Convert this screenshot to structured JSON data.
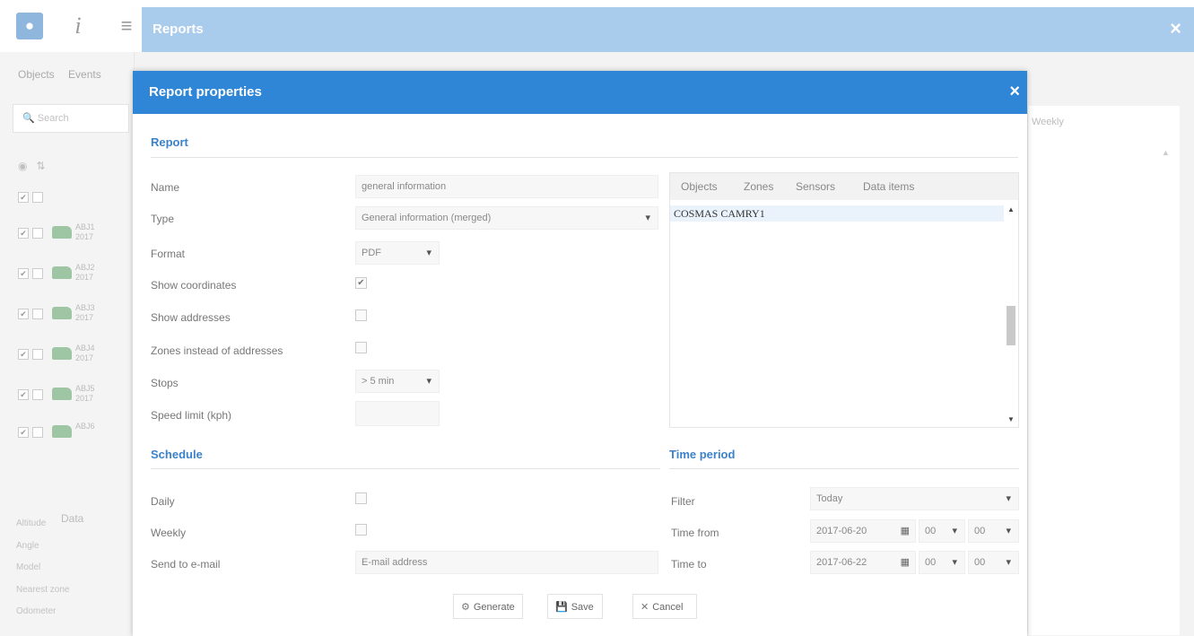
{
  "app": {
    "reports_title": "Reports",
    "close_glyph": "×"
  },
  "left_panel": {
    "tabs": [
      "Objects",
      "Events"
    ],
    "search_placeholder": "Search",
    "objects": [
      {
        "name": "ABJ1",
        "sub": "2017"
      },
      {
        "name": "ABJ2",
        "sub": "2017"
      },
      {
        "name": "ABJ3",
        "sub": "2017"
      },
      {
        "name": "ABJ4",
        "sub": "2017"
      },
      {
        "name": "ABJ5",
        "sub": "2017"
      },
      {
        "name": "ABJ6",
        "sub": ""
      }
    ],
    "data_tab": "Data",
    "properties": [
      "Altitude",
      "Angle",
      "Model",
      "Nearest zone",
      "Odometer"
    ]
  },
  "background": {
    "weekly_label": "Weekly"
  },
  "dialog": {
    "title": "Report properties",
    "close_glyph": "×",
    "report_section": "Report",
    "labels": {
      "name": "Name",
      "type": "Type",
      "format": "Format",
      "show_coordinates": "Show coordinates",
      "show_addresses": "Show addresses",
      "zones_instead": "Zones instead of addresses",
      "stops": "Stops",
      "speed_limit": "Speed limit (kph)"
    },
    "values": {
      "name": "general information",
      "type": "General information (merged)",
      "format": "PDF",
      "stops": "> 5 min",
      "speed_limit": ""
    },
    "checks": {
      "show_coordinates": "✔",
      "show_addresses": "",
      "zones_instead": ""
    },
    "object_tabs": [
      "Objects",
      "Zones",
      "Sensors",
      "Data items"
    ],
    "objects": [
      "COSMAS CAMRY1"
    ],
    "schedule_section": "Schedule",
    "schedule": {
      "daily": "Daily",
      "weekly": "Weekly",
      "send_email": "Send to e-mail",
      "email_placeholder": "E-mail address"
    },
    "time_section": "Time period",
    "time": {
      "filter_label": "Filter",
      "filter_value": "Today",
      "from_label": "Time from",
      "from_date": "2017-06-20",
      "from_hour": "00",
      "from_min": "00",
      "to_label": "Time to",
      "to_date": "2017-06-22",
      "to_hour": "00",
      "to_min": "00"
    },
    "buttons": {
      "generate": "Generate",
      "save": "Save",
      "cancel": "Cancel"
    }
  }
}
